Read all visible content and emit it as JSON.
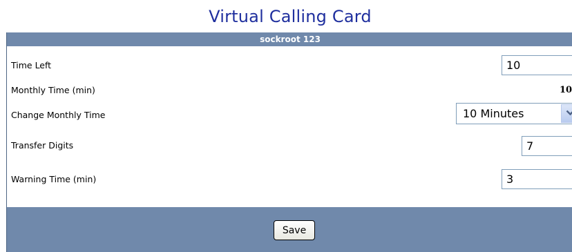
{
  "page": {
    "title": "Virtual Calling Card"
  },
  "card": {
    "header": "sockroot 123",
    "fields": {
      "time_left": {
        "label": "Time Left",
        "value": "10"
      },
      "monthly_time": {
        "label": "Monthly Time (min)",
        "value": "10"
      },
      "change_monthly_time": {
        "label": "Change Monthly Time",
        "selected": "10 Minutes",
        "arrow_icon": "chevron-down-icon"
      },
      "transfer_digits": {
        "label": "Transfer Digits",
        "value": "7"
      },
      "warning_time": {
        "label": "Warning Time (min)",
        "value": "3"
      }
    },
    "save_label": "Save"
  },
  "colors": {
    "title": "#1f2f9e",
    "header_bg": "#7089ab",
    "footer_bg": "#7089ab",
    "input_border": "#7f9db9"
  }
}
